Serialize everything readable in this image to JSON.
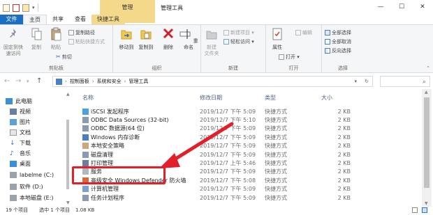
{
  "title": "管理工具",
  "context_tab": "管理",
  "tabs": [
    "文件",
    "主页",
    "共享",
    "查看",
    "快捷工具"
  ],
  "ribbon": {
    "clipboard": {
      "pin": "固定到快\n速访问",
      "copy": "复制",
      "paste": "粘贴",
      "copy_path": "复制路径",
      "paste_shortcut": "粘贴快捷方式",
      "cut": "剪切",
      "label": "剪贴板"
    },
    "organize": {
      "move_to": "移动到",
      "copy_to": "复制到",
      "delete": "删除",
      "rename": "重命名",
      "label": "组织"
    },
    "new": {
      "new_folder": "新建\n文件夹",
      "new_item": "新建项目 ▾",
      "easy_access": "轻松访问 ▾",
      "label": "新建"
    },
    "open": {
      "properties": "属性",
      "open": "打开 ▾",
      "edit": "编辑",
      "label": "打开"
    },
    "select": {
      "select_all": "全部选择",
      "select_none": "全部取消",
      "invert": "反向选择",
      "label": "选择"
    }
  },
  "address": {
    "path": [
      "控制面板",
      "系统和安全",
      "管理工具"
    ]
  },
  "nav": [
    "此电脑",
    "视频",
    "图片",
    "文档",
    "下载",
    "音乐",
    "桌面",
    "labelme (C:)",
    "软件 (D:)",
    "本地磁盘 (E:)"
  ],
  "columns": {
    "name": "名称",
    "date": "修改日期",
    "type": "类型",
    "size": "大小"
  },
  "files": [
    {
      "name": "iSCSI 发起程序",
      "date": "2019/12/7 下午 5:09",
      "type": "快捷方式",
      "size": "2 KB"
    },
    {
      "name": "ODBC Data Sources (32-bit)",
      "date": "2019/12/7 下午 5:10",
      "type": "快捷方式",
      "size": "2 KB"
    },
    {
      "name": "ODBC 数据源(64 位)",
      "date": "2019/12/7 下午 5:09",
      "type": "快捷方式",
      "size": "2 KB"
    },
    {
      "name": "Windows 内存诊断",
      "date": "2019/12/7 下午 5:09",
      "type": "快捷方式",
      "size": "2 KB"
    },
    {
      "name": "本地安全策略",
      "date": "2019/12/7 下午 5:09",
      "type": "快捷方式",
      "size": "2 KB"
    },
    {
      "name": "磁盘清理",
      "date": "2019/12/7 下午 5:09",
      "type": "快捷方式",
      "size": "2 KB"
    },
    {
      "name": "打印管理",
      "date": "2019/12/7 上午 5:46",
      "type": "快捷方式",
      "size": "2 KB"
    },
    {
      "name": "服务",
      "date": "2019/12/7 下午 5:09",
      "type": "快捷方式",
      "size": "2 KB"
    },
    {
      "name": "高级安全 Windows Defender 防火墙",
      "date": "2019/12/7 下午 5:08",
      "type": "快捷方式",
      "size": "2 KB"
    },
    {
      "name": "计算机管理",
      "date": "2019/12/7 下午 5:09",
      "type": "快捷方式",
      "size": "2 KB"
    },
    {
      "name": "任务计划程序",
      "date": "2019/12/7 下午 5:09",
      "type": "快捷方式",
      "size": "2 KB"
    }
  ],
  "search_placeholder": "",
  "status": {
    "count": "19 个项目",
    "selected": "选中 1 个项目",
    "size": "1.08 KB"
  },
  "colors": {
    "accent": "#1a6fc2",
    "context": "#f5d98a",
    "highlight": "#e3202a"
  }
}
